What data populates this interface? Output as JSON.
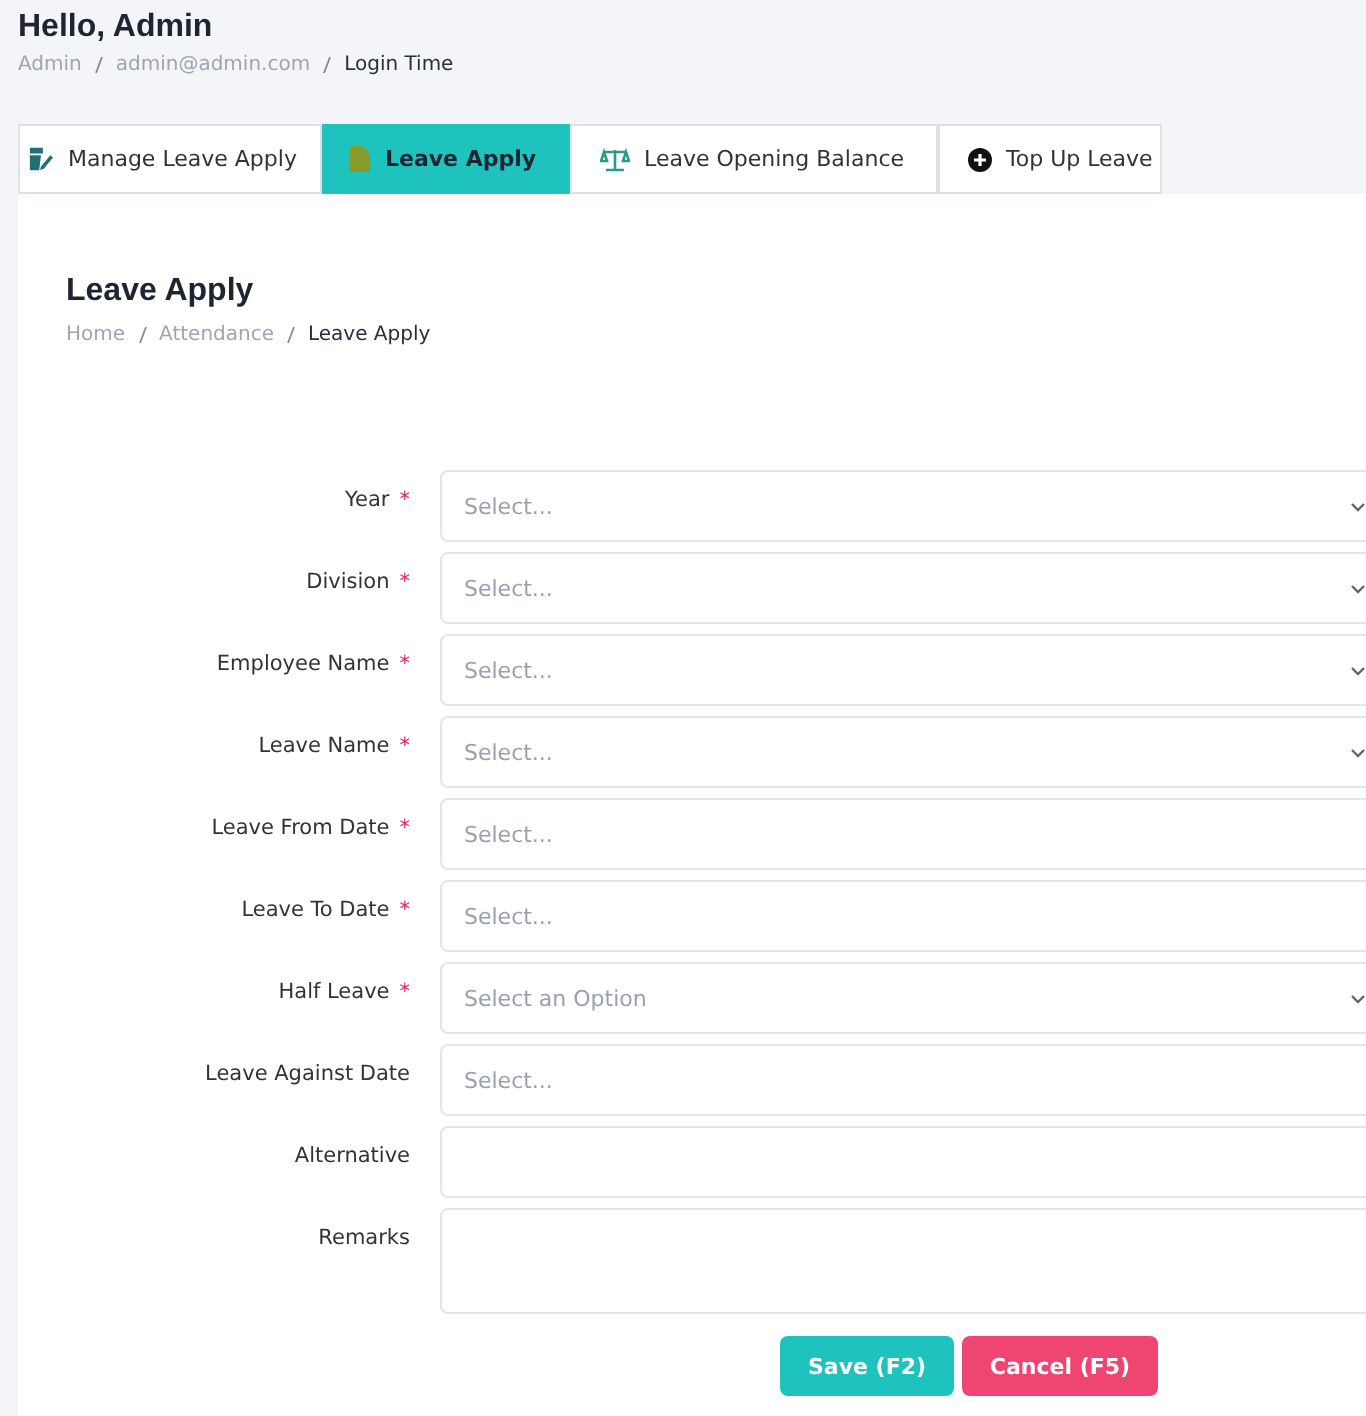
{
  "header": {
    "greeting": "Hello, Admin",
    "breadcrumb": [
      "Admin",
      "admin@admin.com",
      "Login Time"
    ]
  },
  "tabs": [
    {
      "label": "Manage Leave Apply",
      "selected": false
    },
    {
      "label": "Leave Apply",
      "selected": true
    },
    {
      "label": "Leave Opening Balance",
      "selected": false
    },
    {
      "label": "Top Up Leave",
      "selected": false
    }
  ],
  "page": {
    "title": "Leave Apply",
    "breadcrumb": [
      "Home",
      "Attendance",
      "Leave Apply"
    ]
  },
  "fields": [
    {
      "label": "Year",
      "required_mark": "*",
      "kind": "select",
      "placeholder": "Select..."
    },
    {
      "label": "Division",
      "required_mark": "*",
      "kind": "select",
      "placeholder": "Select..."
    },
    {
      "label": "Employee Name",
      "required_mark": "*",
      "kind": "select",
      "placeholder": "Select..."
    },
    {
      "label": "Leave Name",
      "required_mark": "*",
      "kind": "select",
      "placeholder": "Select..."
    },
    {
      "label": "Leave From Date",
      "required_mark": "*",
      "kind": "date",
      "placeholder": "Select..."
    },
    {
      "label": "Leave To Date",
      "required_mark": "*",
      "kind": "date",
      "placeholder": "Select..."
    },
    {
      "label": "Half Leave",
      "required_mark": "*",
      "kind": "select",
      "placeholder": "Select an Option"
    },
    {
      "label": "Leave Against Date",
      "kind": "date",
      "placeholder": "Select..."
    },
    {
      "label": "Alternative",
      "kind": "text"
    },
    {
      "label": "Remarks",
      "kind": "textarea"
    }
  ],
  "buttons": [
    {
      "label": "Save (F2)",
      "kind": "save"
    },
    {
      "label": "Cancel (F5)",
      "kind": "cancel"
    }
  ]
}
